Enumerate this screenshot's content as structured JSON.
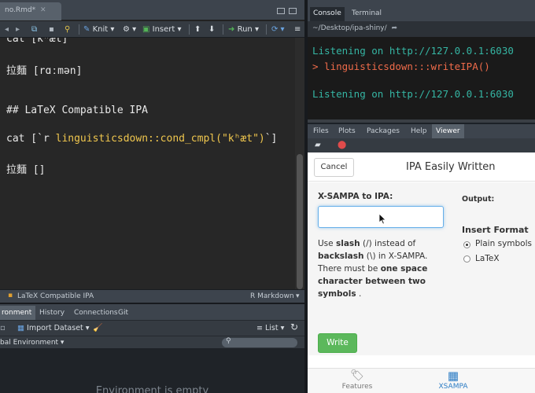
{
  "editor": {
    "file_tab": "no.Rmd*",
    "toolbar": {
      "knit": "Knit",
      "insert": "Insert",
      "run": "Run"
    },
    "code_lines": [
      "cat [kʰæt]",
      "拉麵 [rɑːmən]",
      "## LaTeX Compatible IPA",
      "cat [`r ",
      "linguisticsdown::cond_cmpl(\"kʰæt\")",
      "`]",
      "拉麵 []"
    ],
    "status_section": "LaTeX Compatible IPA",
    "status_mode": "R Markdown"
  },
  "env": {
    "tabs": [
      "ronment",
      "History",
      "Connections",
      "Git"
    ],
    "import_label": "Import Dataset",
    "list_label": "List",
    "scope_label": "bal Environment",
    "empty_text": "Environment is empty"
  },
  "console": {
    "tabs": [
      "Console",
      "Terminal"
    ],
    "path": "~/Desktop/ipa-shiny/",
    "lines": [
      "Listening on http://127.0.0.1:6030",
      "> linguisticsdown:::writeIPA()",
      "Listening on http://127.0.0.1:6030"
    ],
    "colors": {
      "info": "#35b5a3",
      "command": "#ef6b4a"
    }
  },
  "viewer": {
    "tabs": [
      "Files",
      "Plots",
      "Packages",
      "Help",
      "Viewer"
    ],
    "app": {
      "cancel": "Cancel",
      "title": "IPA Easily Written",
      "xsampa_label": "X-SAMPA to IPA:",
      "xsampa_value": "",
      "output_label": "Output:",
      "format_label": "Insert Format",
      "format_options": [
        "Plain symbols",
        "LaTeX"
      ],
      "help": {
        "p1": "Use ",
        "slash": "slash",
        "p2": " (/) instead of ",
        "backslash": "backslash",
        "p3": " (\\) in X-SAMPA. There must be ",
        "space": "one space character between two symbols",
        "p4": " ."
      },
      "write": "Write",
      "footer": [
        "Features",
        "XSAMPA"
      ]
    }
  }
}
